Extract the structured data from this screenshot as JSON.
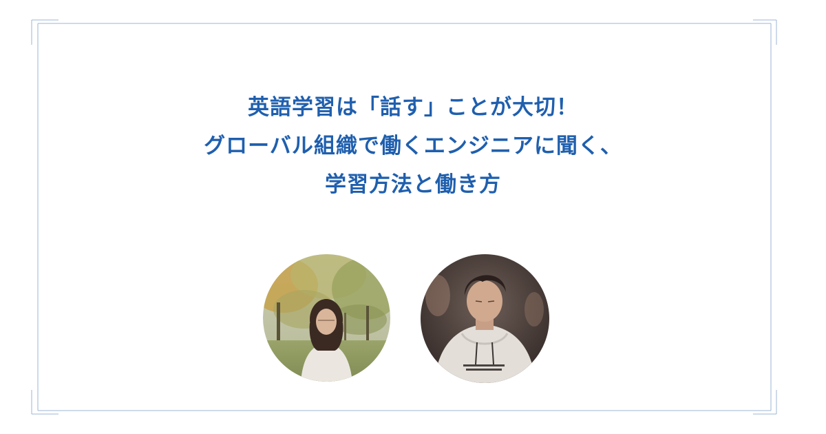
{
  "title": {
    "line1": "英語学習は「話す」ことが大切！",
    "line2": "グローバル組織で働くエンジニアに聞く、",
    "line3": "学習方法と働き方"
  },
  "people": [
    {
      "photo": "woman-in-park-photo"
    },
    {
      "photo": "man-in-white-hoodie-photo"
    }
  ],
  "colors": {
    "title": "#1f5fae",
    "frame": "#9bb6d4",
    "background": "#ffffff"
  }
}
